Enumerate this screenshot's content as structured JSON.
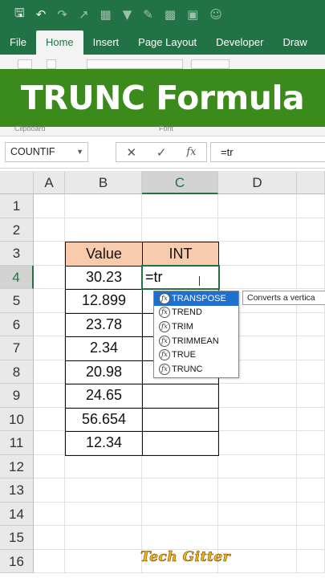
{
  "qat": {
    "icons": [
      "save-icon",
      "undo-icon",
      "redo-icon",
      "chart-icon",
      "table-icon",
      "filter-icon",
      "format-icon",
      "sheet-icon",
      "picture-icon",
      "smile-icon"
    ]
  },
  "tabs": [
    "File",
    "Home",
    "Insert",
    "Page Layout",
    "Developer",
    "Draw"
  ],
  "active_tab": "Home",
  "banner": {
    "title": "TRUNC Formula"
  },
  "ribbon_groups": [
    "Clipboard",
    "Font"
  ],
  "formula_bar": {
    "name_box": "COUNTIF",
    "cancel_symbol": "✕",
    "enter_symbol": "✓",
    "fx_label": "fx",
    "formula": "=tr"
  },
  "columns": [
    "A",
    "B",
    "C",
    "D"
  ],
  "rows": [
    "1",
    "2",
    "3",
    "4",
    "5",
    "6",
    "7",
    "8",
    "9",
    "10",
    "11",
    "12",
    "13",
    "14",
    "15",
    "16"
  ],
  "table": {
    "header_value": "Value",
    "header_int": "INT",
    "values": [
      "30.23",
      "12.899",
      "23.78",
      "2.34",
      "20.98",
      "24.65",
      "56.654",
      "12.34"
    ],
    "active_cell_text": "=tr"
  },
  "autocomplete": {
    "items": [
      "TRANSPOSE",
      "TREND",
      "TRIM",
      "TRIMMEAN",
      "TRUE",
      "TRUNC"
    ],
    "selected_index": 0,
    "fx_glyph": "fx",
    "tooltip": "Converts a vertica"
  },
  "watermark": "Tech Gitter",
  "colors": {
    "excel_green": "#217346",
    "banner_green": "#3a8a1c",
    "header_fill": "#f8cbad",
    "selection_blue": "#1e6fd0"
  }
}
